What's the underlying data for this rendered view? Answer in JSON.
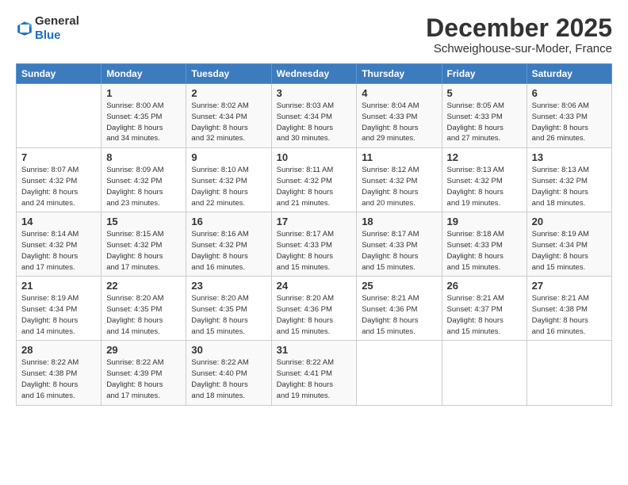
{
  "header": {
    "logo": {
      "line1": "General",
      "line2": "Blue"
    },
    "title": "December 2025",
    "location": "Schweighouse-sur-Moder, France"
  },
  "weekdays": [
    "Sunday",
    "Monday",
    "Tuesday",
    "Wednesday",
    "Thursday",
    "Friday",
    "Saturday"
  ],
  "weeks": [
    [
      {
        "day": "",
        "info": ""
      },
      {
        "day": "1",
        "info": "Sunrise: 8:00 AM\nSunset: 4:35 PM\nDaylight: 8 hours\nand 34 minutes."
      },
      {
        "day": "2",
        "info": "Sunrise: 8:02 AM\nSunset: 4:34 PM\nDaylight: 8 hours\nand 32 minutes."
      },
      {
        "day": "3",
        "info": "Sunrise: 8:03 AM\nSunset: 4:34 PM\nDaylight: 8 hours\nand 30 minutes."
      },
      {
        "day": "4",
        "info": "Sunrise: 8:04 AM\nSunset: 4:33 PM\nDaylight: 8 hours\nand 29 minutes."
      },
      {
        "day": "5",
        "info": "Sunrise: 8:05 AM\nSunset: 4:33 PM\nDaylight: 8 hours\nand 27 minutes."
      },
      {
        "day": "6",
        "info": "Sunrise: 8:06 AM\nSunset: 4:33 PM\nDaylight: 8 hours\nand 26 minutes."
      }
    ],
    [
      {
        "day": "7",
        "info": "Sunrise: 8:07 AM\nSunset: 4:32 PM\nDaylight: 8 hours\nand 24 minutes."
      },
      {
        "day": "8",
        "info": "Sunrise: 8:09 AM\nSunset: 4:32 PM\nDaylight: 8 hours\nand 23 minutes."
      },
      {
        "day": "9",
        "info": "Sunrise: 8:10 AM\nSunset: 4:32 PM\nDaylight: 8 hours\nand 22 minutes."
      },
      {
        "day": "10",
        "info": "Sunrise: 8:11 AM\nSunset: 4:32 PM\nDaylight: 8 hours\nand 21 minutes."
      },
      {
        "day": "11",
        "info": "Sunrise: 8:12 AM\nSunset: 4:32 PM\nDaylight: 8 hours\nand 20 minutes."
      },
      {
        "day": "12",
        "info": "Sunrise: 8:13 AM\nSunset: 4:32 PM\nDaylight: 8 hours\nand 19 minutes."
      },
      {
        "day": "13",
        "info": "Sunrise: 8:13 AM\nSunset: 4:32 PM\nDaylight: 8 hours\nand 18 minutes."
      }
    ],
    [
      {
        "day": "14",
        "info": "Sunrise: 8:14 AM\nSunset: 4:32 PM\nDaylight: 8 hours\nand 17 minutes."
      },
      {
        "day": "15",
        "info": "Sunrise: 8:15 AM\nSunset: 4:32 PM\nDaylight: 8 hours\nand 17 minutes."
      },
      {
        "day": "16",
        "info": "Sunrise: 8:16 AM\nSunset: 4:32 PM\nDaylight: 8 hours\nand 16 minutes."
      },
      {
        "day": "17",
        "info": "Sunrise: 8:17 AM\nSunset: 4:33 PM\nDaylight: 8 hours\nand 15 minutes."
      },
      {
        "day": "18",
        "info": "Sunrise: 8:17 AM\nSunset: 4:33 PM\nDaylight: 8 hours\nand 15 minutes."
      },
      {
        "day": "19",
        "info": "Sunrise: 8:18 AM\nSunset: 4:33 PM\nDaylight: 8 hours\nand 15 minutes."
      },
      {
        "day": "20",
        "info": "Sunrise: 8:19 AM\nSunset: 4:34 PM\nDaylight: 8 hours\nand 15 minutes."
      }
    ],
    [
      {
        "day": "21",
        "info": "Sunrise: 8:19 AM\nSunset: 4:34 PM\nDaylight: 8 hours\nand 14 minutes."
      },
      {
        "day": "22",
        "info": "Sunrise: 8:20 AM\nSunset: 4:35 PM\nDaylight: 8 hours\nand 14 minutes."
      },
      {
        "day": "23",
        "info": "Sunrise: 8:20 AM\nSunset: 4:35 PM\nDaylight: 8 hours\nand 15 minutes."
      },
      {
        "day": "24",
        "info": "Sunrise: 8:20 AM\nSunset: 4:36 PM\nDaylight: 8 hours\nand 15 minutes."
      },
      {
        "day": "25",
        "info": "Sunrise: 8:21 AM\nSunset: 4:36 PM\nDaylight: 8 hours\nand 15 minutes."
      },
      {
        "day": "26",
        "info": "Sunrise: 8:21 AM\nSunset: 4:37 PM\nDaylight: 8 hours\nand 15 minutes."
      },
      {
        "day": "27",
        "info": "Sunrise: 8:21 AM\nSunset: 4:38 PM\nDaylight: 8 hours\nand 16 minutes."
      }
    ],
    [
      {
        "day": "28",
        "info": "Sunrise: 8:22 AM\nSunset: 4:38 PM\nDaylight: 8 hours\nand 16 minutes."
      },
      {
        "day": "29",
        "info": "Sunrise: 8:22 AM\nSunset: 4:39 PM\nDaylight: 8 hours\nand 17 minutes."
      },
      {
        "day": "30",
        "info": "Sunrise: 8:22 AM\nSunset: 4:40 PM\nDaylight: 8 hours\nand 18 minutes."
      },
      {
        "day": "31",
        "info": "Sunrise: 8:22 AM\nSunset: 4:41 PM\nDaylight: 8 hours\nand 19 minutes."
      },
      {
        "day": "",
        "info": ""
      },
      {
        "day": "",
        "info": ""
      },
      {
        "day": "",
        "info": ""
      }
    ]
  ]
}
